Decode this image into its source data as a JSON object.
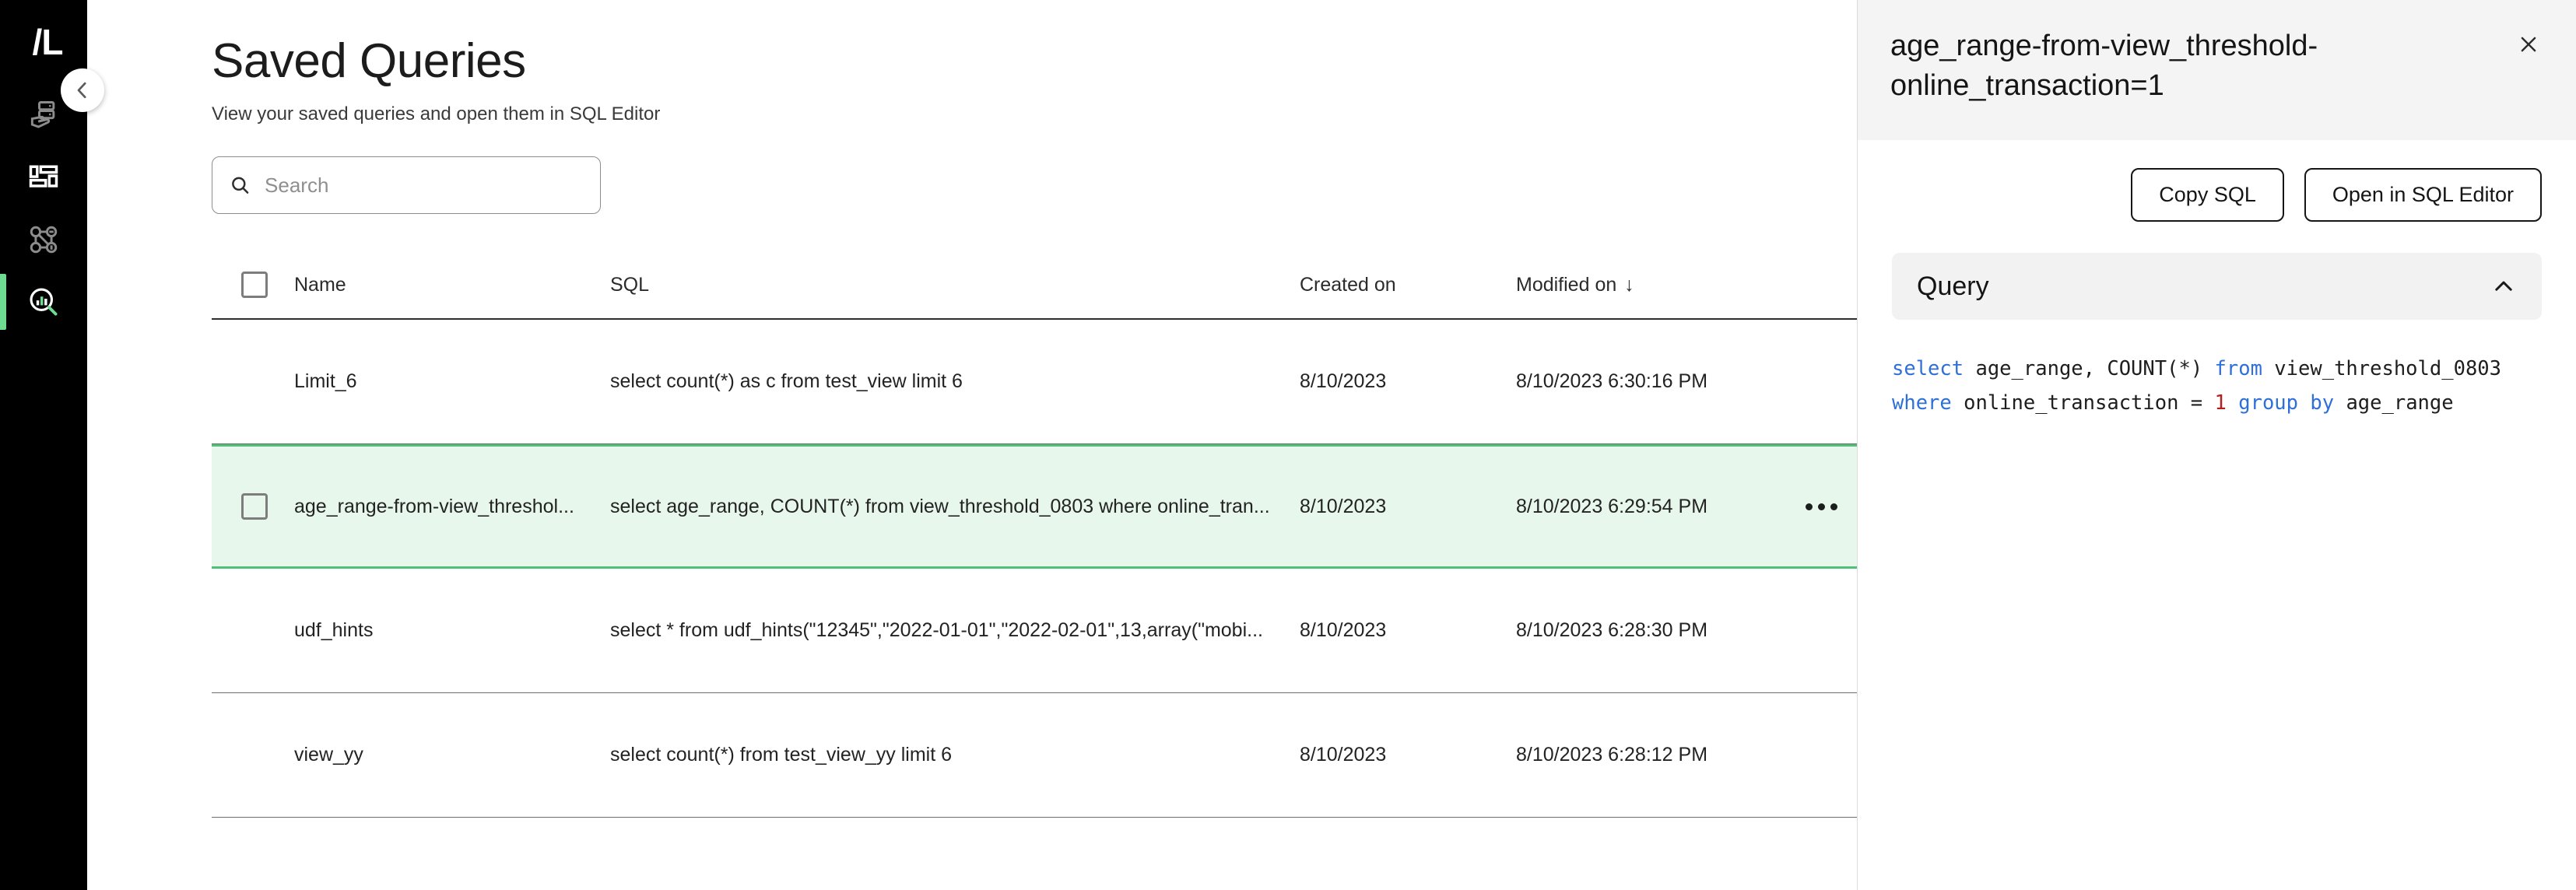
{
  "rail": {
    "logo": "/L",
    "items": [
      {
        "name": "data-delivery-icon",
        "label": "Data Delivery",
        "active": false
      },
      {
        "name": "dashboard-icon",
        "label": "Dashboard",
        "active": false
      },
      {
        "name": "lineage-graph-icon",
        "label": "Lineage",
        "active": false
      },
      {
        "name": "query-insights-icon",
        "label": "Query Insights",
        "active": true
      }
    ],
    "active_indicator_color": "#6ddb92",
    "background": "#000000"
  },
  "collapse_button": {
    "icon": "chevron-left-icon",
    "label": "Collapse navigation"
  },
  "page": {
    "title": "Saved Queries",
    "subtitle": "View your saved queries and open them in SQL Editor"
  },
  "search": {
    "placeholder": "Search",
    "value": "",
    "icon": "search-icon"
  },
  "table": {
    "columns": {
      "name": "Name",
      "sql": "SQL",
      "created_on": "Created on",
      "modified_on": "Modified on",
      "sort_indicator": "↓"
    },
    "rows": [
      {
        "name": "Limit_6",
        "sql": "select count(*) as c from test_view limit 6",
        "created_on": "8/10/2023",
        "modified_on": "8/10/2023 6:30:16 PM",
        "selected": false,
        "show_checkbox": false,
        "show_actions": false
      },
      {
        "name": "age_range-from-view_threshol...",
        "sql": "select age_range, COUNT(*) from view_threshold_0803 where online_tran...",
        "created_on": "8/10/2023",
        "modified_on": "8/10/2023 6:29:54 PM",
        "selected": true,
        "show_checkbox": true,
        "show_actions": true
      },
      {
        "name": "udf_hints",
        "sql": "select * from udf_hints(\"12345\",\"2022-01-01\",\"2022-02-01\",13,array(\"mobi...",
        "created_on": "8/10/2023",
        "modified_on": "8/10/2023 6:28:30 PM",
        "selected": false,
        "show_checkbox": false,
        "show_actions": false
      },
      {
        "name": "view_yy",
        "sql": "select count(*) from test_view_yy limit 6",
        "created_on": "8/10/2023",
        "modified_on": "8/10/2023 6:28:12 PM",
        "selected": false,
        "show_checkbox": false,
        "show_actions": false
      }
    ],
    "selected_row_background": "#e7f7ec",
    "selected_row_border": "#4fbf79"
  },
  "panel": {
    "title": "age_range-from-view_threshold-online_transaction=1",
    "close_icon": "close-icon",
    "buttons": {
      "copy_sql": "Copy SQL",
      "open_in_sql_editor": "Open in SQL Editor"
    },
    "query_section": {
      "label": "Query",
      "collapse_icon": "chevron-up-icon",
      "sql_tokens": [
        {
          "t": "select",
          "k": "kw"
        },
        {
          "t": " age_range, COUNT(*) ",
          "k": "plain"
        },
        {
          "t": "from",
          "k": "kw"
        },
        {
          "t": " view_threshold_0803\n",
          "k": "plain"
        },
        {
          "t": "where",
          "k": "kw"
        },
        {
          "t": " online_transaction = ",
          "k": "plain"
        },
        {
          "t": "1",
          "k": "num"
        },
        {
          "t": " ",
          "k": "plain"
        },
        {
          "t": "group",
          "k": "kw"
        },
        {
          "t": " ",
          "k": "plain"
        },
        {
          "t": "by",
          "k": "kw"
        },
        {
          "t": " age_range",
          "k": "plain"
        }
      ],
      "keyword_color": "#2f6fd8",
      "number_color": "#b02020"
    }
  }
}
